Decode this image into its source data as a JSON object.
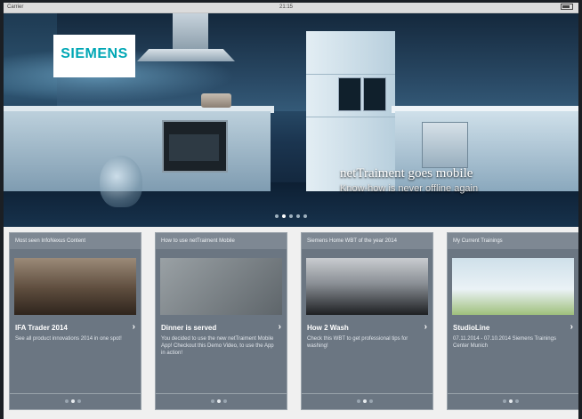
{
  "status_bar": {
    "carrier": "Carrier",
    "time": "21:15"
  },
  "hero": {
    "brand": "SIEMENS",
    "title": "netTraiment goes mobile",
    "subtitle": "Know-how is never offline again",
    "slide_count": 5,
    "active_slide": 1
  },
  "cards": [
    {
      "header": "Most seen InfoNexus Content",
      "title": "IFA Trader 2014",
      "text": "See all product innovations 2014 in one spot!",
      "page_count": 3,
      "active_page": 1
    },
    {
      "header": "How to use netTraiment Mobile",
      "title": "Dinner is served",
      "text": "You decided to use the new netTraiment Mobile App! Checkout this Demo Video, to use the App in action!",
      "page_count": 3,
      "active_page": 1
    },
    {
      "header": "Siemens Home WBT of the year 2014",
      "title": "How 2 Wash",
      "text": "Check this WBT to get professional tips for washing!",
      "page_count": 3,
      "active_page": 1
    },
    {
      "header": "My Current Trainings",
      "title": "StudioLine",
      "text": "07.11.2014 - 07.10.2014 Siemens Trainings Center Munich",
      "page_count": 3,
      "active_page": 1
    }
  ]
}
